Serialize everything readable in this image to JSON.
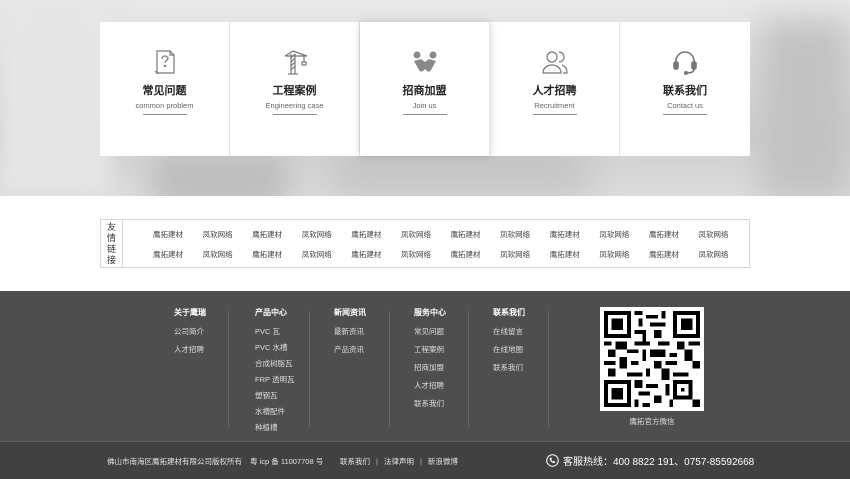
{
  "cards": [
    {
      "cn": "常见问题",
      "en": "common problem",
      "icon": "question-doc-icon"
    },
    {
      "cn": "工程案例",
      "en": "Engineering case",
      "icon": "crane-icon"
    },
    {
      "cn": "招商加盟",
      "en": "Join us",
      "icon": "handshake-icon"
    },
    {
      "cn": "人才招聘",
      "en": "Recruitment",
      "icon": "people-icon"
    },
    {
      "cn": "联系我们",
      "en": "Contact us",
      "icon": "headset-icon"
    }
  ],
  "friend_links": {
    "label": [
      "友",
      "情",
      "链",
      "接"
    ],
    "row1": [
      "鹰拓建材",
      "凤软网络",
      "鹰拓建材",
      "凤软网络",
      "鹰拓建材",
      "凤软网络",
      "鹰拓建材",
      "凤软网络",
      "鹰拓建材",
      "凤软网络",
      "鹰拓建材",
      "凤软网络"
    ],
    "row2": [
      "鹰拓建材",
      "凤软网络",
      "鹰拓建材",
      "凤软网络",
      "鹰拓建材",
      "凤软网络",
      "鹰拓建材",
      "凤软网络",
      "鹰拓建材",
      "凤软网络",
      "鹰拓建材",
      "凤软网络"
    ]
  },
  "footer": {
    "about": {
      "title": "关于鹰瑞",
      "items": [
        "公司简介",
        "人才招聘"
      ]
    },
    "products": {
      "title": "产品中心",
      "items": [
        "PVC 瓦",
        "PVC 水槽",
        "合成树脂瓦",
        "FRP 透明瓦",
        "塑钢瓦",
        "水槽配件",
        "种植槽"
      ]
    },
    "news": {
      "title": "新闻资讯",
      "items": [
        "最新资讯",
        "产品资讯"
      ]
    },
    "service": {
      "title": "服务中心",
      "items": [
        "常见问题",
        "工程案例",
        "招商加盟",
        "人才招聘",
        "联系我们"
      ]
    },
    "contact": {
      "title": "联系我们",
      "items": [
        "在线留言",
        "在线地图",
        "联系我们"
      ]
    },
    "qr_caption": "鹰拓官方微信"
  },
  "bottom": {
    "copyright": "佛山市南海区鹰拓建材有限公司版权所有",
    "icp": "粤 icp 备 11007708 号",
    "links": [
      "联系我们",
      "法律声明",
      "新浪微博"
    ],
    "hotline": "客服热线：400 8822 191、0757-85592668"
  }
}
